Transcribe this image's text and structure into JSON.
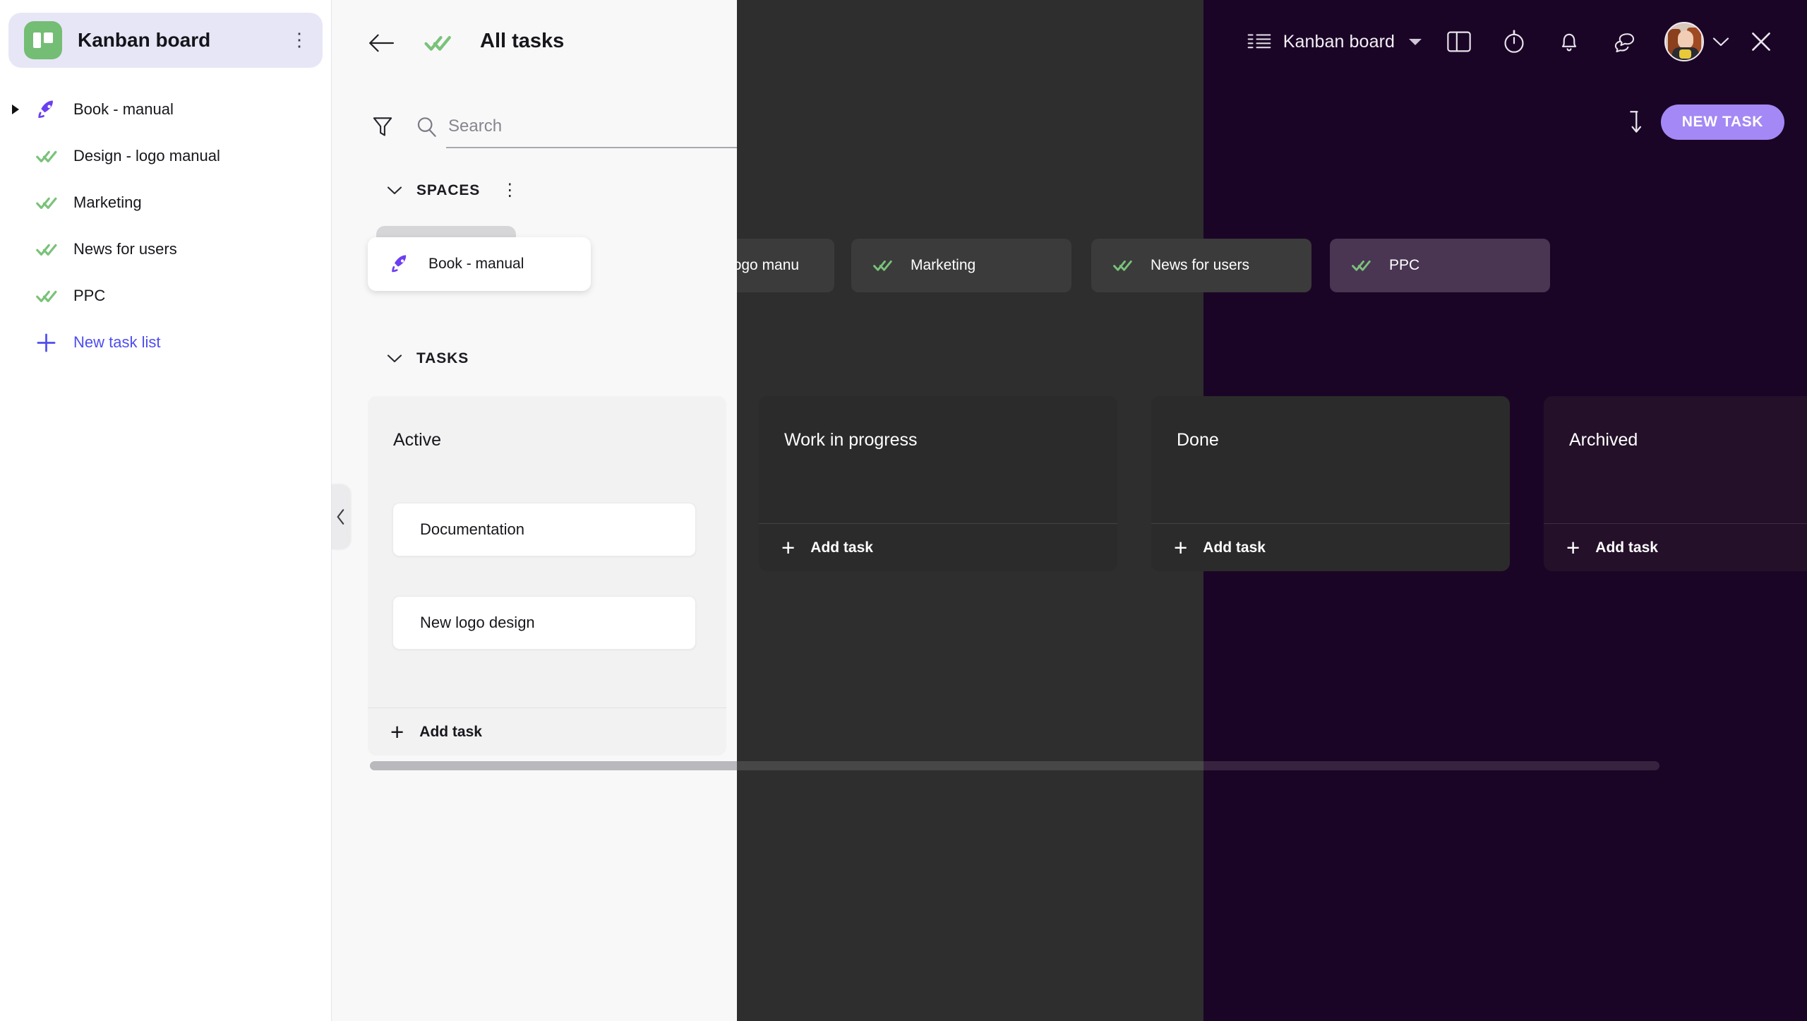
{
  "sidebar": {
    "board_title": "Kanban board",
    "board_icon": "kanban-board-icon",
    "menu_icon": "kebab-menu-icon",
    "items": [
      {
        "label": "Book - manual",
        "icon": "rocket-icon",
        "expandable": true
      },
      {
        "label": "Design - logo manual",
        "icon": "double-check-icon",
        "expandable": false
      },
      {
        "label": "Marketing",
        "icon": "double-check-icon",
        "expandable": false
      },
      {
        "label": "News for users",
        "icon": "double-check-icon",
        "expandable": false
      },
      {
        "label": "PPC",
        "icon": "double-check-icon",
        "expandable": false
      }
    ],
    "new_list_label": "New task list",
    "new_list_icon": "plus-icon"
  },
  "header": {
    "back_icon": "back-arrow-icon",
    "list_icon": "double-check-icon",
    "title": "All tasks"
  },
  "toolbar": {
    "list_icon": "list-view-icon",
    "board_name": "Kanban board",
    "caret_icon": "chevron-down-icon",
    "split_view_icon": "split-view-icon",
    "timer_icon": "stopwatch-icon",
    "bell_icon": "notification-bell-icon",
    "chat_icon": "chat-bubbles-icon",
    "avatar_icon": "user-avatar",
    "user_caret_icon": "chevron-down-icon",
    "close_icon": "close-icon"
  },
  "actions": {
    "sort_icon": "sort-descending-icon",
    "new_task_label": "NEW TASK"
  },
  "search": {
    "filter_icon": "filter-funnel-icon",
    "search_icon": "search-icon",
    "placeholder": "Search"
  },
  "sections": {
    "spaces": {
      "label": "SPACES",
      "caret_icon": "chevron-down-icon",
      "menu_icon": "kebab-menu-icon"
    },
    "tasks": {
      "label": "TASKS",
      "caret_icon": "chevron-down-icon"
    }
  },
  "spaces": [
    {
      "label": "Book - manual",
      "icon": "rocket-icon",
      "active": true,
      "tinted": false
    },
    {
      "label": "Design - logo manu",
      "icon": "double-check-icon",
      "active": false,
      "tinted": false
    },
    {
      "label": "Marketing",
      "icon": "double-check-icon",
      "active": false,
      "tinted": false
    },
    {
      "label": "News for users",
      "icon": "double-check-icon",
      "active": false,
      "tinted": false
    },
    {
      "label": "PPC",
      "icon": "double-check-icon",
      "active": false,
      "tinted": true
    }
  ],
  "columns": [
    {
      "title": "Active",
      "add_label": "Add task",
      "add_icon": "plus-icon",
      "theme": "light"
    },
    {
      "title": "Work in progress",
      "add_label": "Add task",
      "add_icon": "plus-icon",
      "theme": "dark"
    },
    {
      "title": "Done",
      "add_label": "Add task",
      "add_icon": "plus-icon",
      "theme": "dark"
    },
    {
      "title": "Archived",
      "add_label": "Add task",
      "add_icon": "plus-icon",
      "theme": "purple"
    }
  ],
  "tasks": [
    {
      "title": "Documentation",
      "column": "Active"
    },
    {
      "title": "New logo design",
      "column": "Active"
    }
  ],
  "collapse_handle": {
    "icon": "chevron-left-icon"
  },
  "colors": {
    "accent_purple": "#a488f5",
    "link_blue": "#4d4df0",
    "check_green": "#7ac27a",
    "rocket_purple": "#6c3ff0",
    "board_green": "#74bd74",
    "dark_bg": "#2e2e2e",
    "purple_overlay": "#1b0526",
    "light_panel": "#f8f8f9"
  }
}
